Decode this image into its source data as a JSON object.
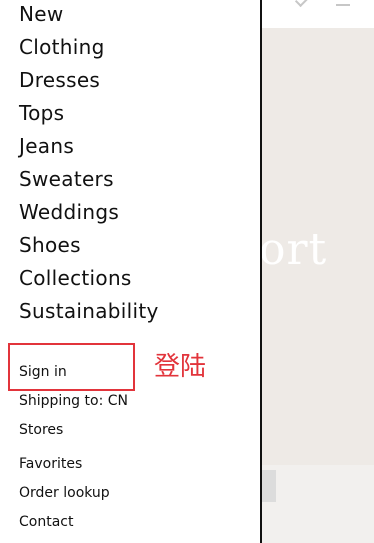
{
  "nav": {
    "primary": [
      "New",
      "Clothing",
      "Dresses",
      "Tops",
      "Jeans",
      "Sweaters",
      "Weddings",
      "Shoes",
      "Collections",
      "Sustainability"
    ],
    "secondary": [
      "Sign in",
      "Shipping to: CN",
      "Stores",
      "Favorites",
      "Order lookup",
      "Contact"
    ]
  },
  "hero": {
    "text": "ort"
  },
  "annotation": {
    "label": "登陆",
    "color": "#e2343b"
  }
}
